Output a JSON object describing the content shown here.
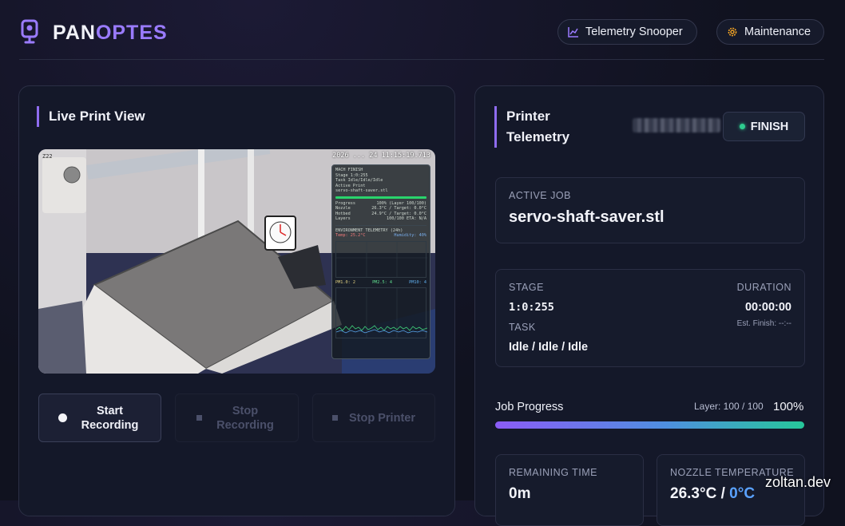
{
  "header": {
    "brand_part1": "PAN",
    "brand_part2": "OPTES",
    "telemetry_button": "Telemetry Snooper",
    "maintenance_button": "Maintenance"
  },
  "live_view": {
    "title": "Live Print View",
    "timestamp": "2026 ... 24 11:15:19.713",
    "corner_label": "Z22",
    "overlay": {
      "lines": [
        "MACH  FINISH",
        "Stage  1:0:255",
        "Task   Idle/Idle/Idle",
        "Active Print",
        "servo-shaft-saver.stl"
      ],
      "rows": [
        [
          "Progress",
          "100% (Layer 100/100)"
        ],
        [
          "Nozzle",
          "26.3°C / Target: 0.0°C"
        ],
        [
          "Hotbed",
          "24.9°C / Target: 0.0°C"
        ],
        [
          "Layers",
          "100/100  ETA: N/A"
        ]
      ],
      "env_title": "ENVIRONMENT TELEMETRY (24h)",
      "env_left": "Temp: 25.2°C",
      "env_right": "Humidity: 40%",
      "pm_row": [
        "PM1.0: 2",
        "PM2.5: 4",
        "PM10: 4"
      ]
    }
  },
  "actions": {
    "start_recording": "Start Recording",
    "stop_recording": "Stop Recording",
    "stop_printer": "Stop Printer"
  },
  "telemetry": {
    "title_line1": "Printer",
    "title_line2": "Telemetry",
    "status": "FINISH",
    "active_job_label": "ACTIVE JOB",
    "active_job": "servo-shaft-saver.stl",
    "stage_label": "STAGE",
    "stage": "1:0:255",
    "duration_label": "DURATION",
    "duration": "00:00:00",
    "est_finish": "Est. Finish: --:--",
    "task_label": "TASK",
    "task": "Idle / Idle / Idle",
    "job_progress_label": "Job Progress",
    "layer_text": "Layer: 100 / 100",
    "progress_percent_text": "100%",
    "progress_value": 100,
    "remaining_label": "REMAINING TIME",
    "remaining": "0m",
    "nozzle_label": "NOZZLE TEMPERATURE",
    "nozzle_current": "26.3°C",
    "nozzle_sep": " / ",
    "nozzle_target": "0°C"
  },
  "watermark": "zoltan.dev",
  "colors": {
    "accent_purple": "#9a7bff",
    "status_green": "#2ecc8f",
    "target_blue": "#5aa2ff"
  }
}
